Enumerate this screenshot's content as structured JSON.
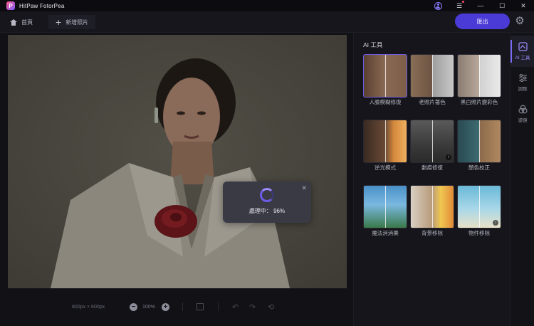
{
  "window": {
    "title": "HitPaw FotorPea",
    "logo_letter": "P"
  },
  "titlebar": {
    "icons": [
      "user-icon",
      "menu-icon",
      "minimize-icon",
      "maximize-icon",
      "close-icon"
    ]
  },
  "toolbar": {
    "home_label": "首頁",
    "new_label": "新增照片",
    "export_label": "匯出"
  },
  "canvas": {
    "dimensions": "800px × 600px",
    "zoom": "100%"
  },
  "processing": {
    "text": "處理中：",
    "percent": "96%",
    "progress": 0.96
  },
  "panel": {
    "title": "AI 工具",
    "tools": [
      {
        "label": "人臉模糊修復"
      },
      {
        "label": "老照片著色"
      },
      {
        "label": "黑白照片變彩色"
      },
      {
        "label": "逆光模式"
      },
      {
        "label": "劃痕修復"
      },
      {
        "label": "顏色校正"
      },
      {
        "label": "魔法消消樂"
      },
      {
        "label": "背景移除"
      },
      {
        "label": "物件移除"
      }
    ]
  },
  "rail": {
    "items": [
      {
        "label": "AI 工具"
      },
      {
        "label": "調整"
      },
      {
        "label": "濾鏡"
      }
    ]
  },
  "colors": {
    "accent": "#6c5ce7",
    "export_button": "#4a3bd6",
    "background": "#0f0f14"
  }
}
